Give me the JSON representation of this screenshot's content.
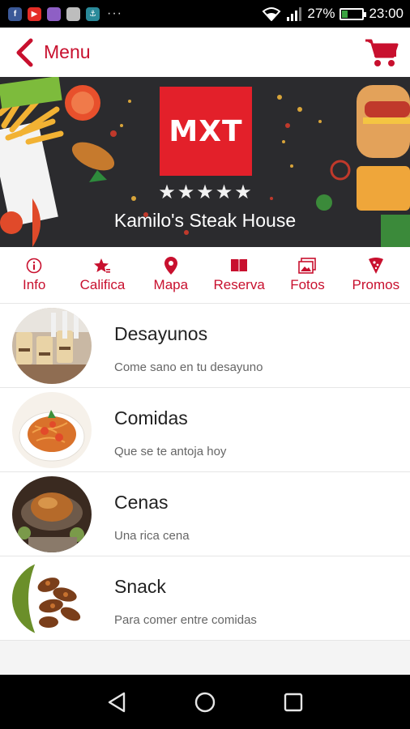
{
  "status": {
    "battery": "27%",
    "battery_level": 0.27,
    "time": "23:00",
    "notification_apps": [
      "facebook-icon",
      "youtube-icon",
      "app-icon",
      "app-icon",
      "app-icon"
    ],
    "more": "···"
  },
  "appbar": {
    "title": "Menu"
  },
  "hero": {
    "logo_text": "MXT",
    "rating_stars": 5,
    "restaurant_name": "Kamilo's Steak House"
  },
  "tabs": [
    {
      "label": "Info",
      "icon": "info-icon"
    },
    {
      "label": "Califica",
      "icon": "star-rate-icon"
    },
    {
      "label": "Mapa",
      "icon": "map-pin-icon"
    },
    {
      "label": "Reserva",
      "icon": "book-icon"
    },
    {
      "label": "Fotos",
      "icon": "photos-icon"
    },
    {
      "label": "Promos",
      "icon": "pizza-icon"
    }
  ],
  "menu_items": [
    {
      "title": "Desayunos",
      "subtitle": "Come sano en tu desayuno"
    },
    {
      "title": "Comidas",
      "subtitle": "Que se te antoja hoy"
    },
    {
      "title": "Cenas",
      "subtitle": "Una rica cena"
    },
    {
      "title": "Snack",
      "subtitle": "Para comer entre comidas"
    }
  ],
  "colors": {
    "accent": "#c8102e",
    "logo_red": "#e3202a"
  }
}
